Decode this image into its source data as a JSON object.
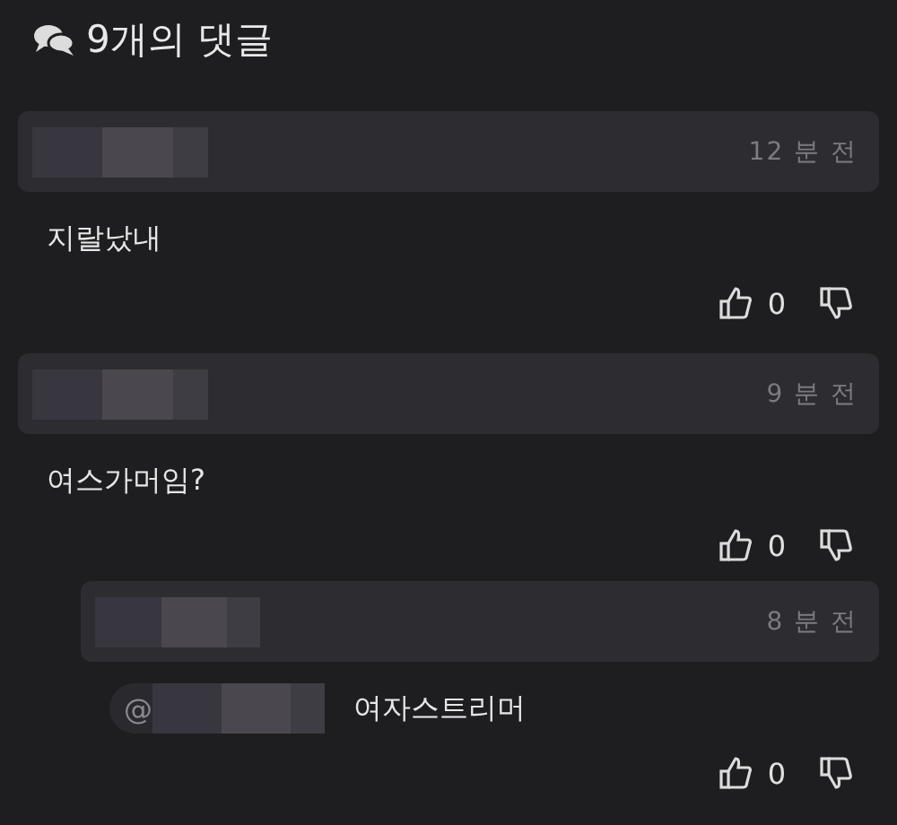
{
  "header": {
    "title": "9개의 댓글"
  },
  "comments": [
    {
      "time": "12 분 전",
      "body": "지랄났내",
      "likes": "0"
    },
    {
      "time": "9 분 전",
      "body": "여스가머임?",
      "likes": "0",
      "children": [
        {
          "time": "8 분 전",
          "mention": "@",
          "body": "여자스트리머",
          "likes": "0"
        }
      ]
    }
  ]
}
